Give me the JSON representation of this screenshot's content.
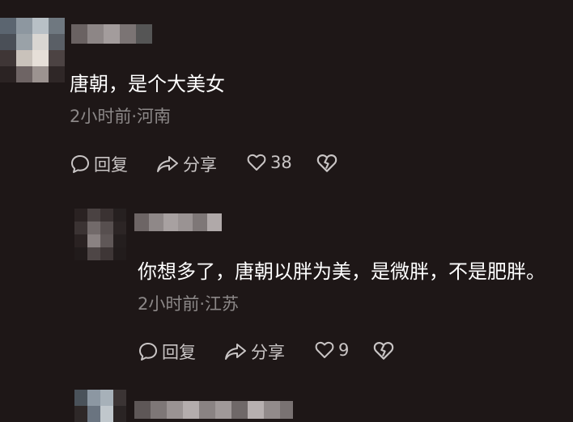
{
  "comments": [
    {
      "text": "唐朝，是个大美女",
      "meta": "2小时前·河南",
      "actions": {
        "reply": "回复",
        "share": "分享",
        "likes": "38"
      }
    },
    {
      "text": "你想多了，唐朝以胖为美，是微胖，不是肥胖。",
      "meta": "2小时前·江苏",
      "actions": {
        "reply": "回复",
        "share": "分享",
        "likes": "9"
      }
    }
  ],
  "colors": {
    "background": "#1e1717",
    "text": "#ffffff",
    "meta": "#8c8888",
    "action": "#c9c5c5"
  }
}
